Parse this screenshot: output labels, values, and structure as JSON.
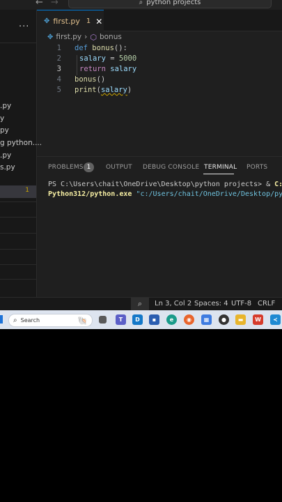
{
  "window": {
    "search_label": "python projects",
    "search_icon": "search-icon"
  },
  "sidebar": {
    "dots": "···",
    "items": [
      {
        "label": ".py"
      },
      {
        "label": "y"
      },
      {
        "label": "py"
      },
      {
        "label": "g python...."
      },
      {
        "label": ".py"
      },
      {
        "label": "s.py"
      }
    ],
    "selected_badge": "1"
  },
  "tab": {
    "label": "first.py",
    "badge": "1",
    "close": "✕"
  },
  "breadcrumb": {
    "file": "first.py",
    "separator": "›",
    "symbol": "bonus"
  },
  "editor": {
    "line_numbers": [
      "1",
      "2",
      "3",
      "4",
      "5"
    ],
    "active_line": 3,
    "lines": [
      {
        "kw": "def",
        "fn": "bonus",
        "rest": "():"
      },
      {
        "var": "salary",
        "op": " = ",
        "num": "5000"
      },
      {
        "kw": "return",
        "var": "salary"
      },
      {
        "fn": "bonus",
        "rest": "()"
      },
      {
        "fn": "print",
        "open": "(",
        "var": "salary",
        "close": ")"
      }
    ]
  },
  "panel": {
    "tabs": [
      {
        "label": "PROBLEMS"
      },
      {
        "label": "OUTPUT"
      },
      {
        "label": "DEBUG CONSOLE"
      },
      {
        "label": "TERMINAL"
      },
      {
        "label": "PORTS"
      }
    ],
    "problems_count": "1",
    "active_tab": "TERMINAL"
  },
  "terminal": {
    "line1_prompt": "PS C:\\Users\\chait\\OneDrive\\Desktop\\python projects> ",
    "line1_amp": "& ",
    "line1_cmd": "C:/U",
    "line2_cmd": "Python312/python.exe",
    "line2_arg": " \"c:/Users/chait/OneDrive/Desktop/pyth"
  },
  "statusbar": {
    "position": "Ln 3, Col 2",
    "spaces": "Spaces: 4",
    "encoding": "UTF-8",
    "eol": "CRLF"
  },
  "taskbar": {
    "search_text": "Search"
  },
  "colors": {
    "accent": "#0078d4",
    "terminal_yellow": "#f9f1a5",
    "modified_tab": "#e2c08d"
  }
}
